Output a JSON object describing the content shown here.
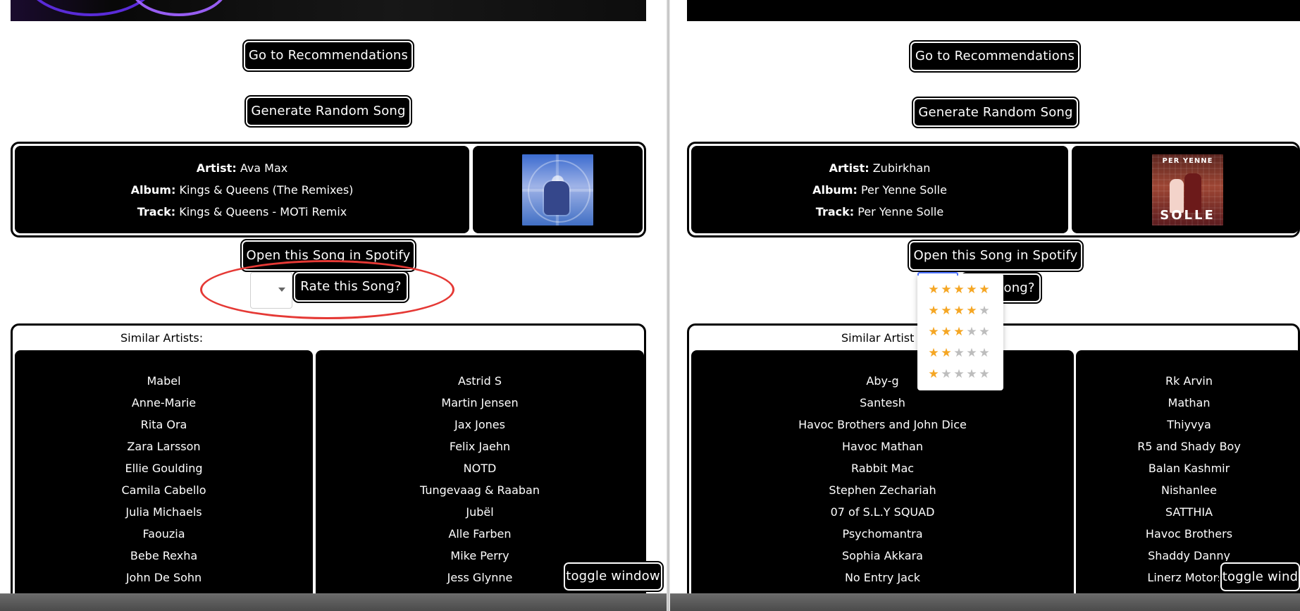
{
  "left_panel": {
    "buttons": {
      "recommendations": "Go to Recommendations",
      "random_song": "Generate Random Song",
      "open_spotify": "Open this Song in Spotify",
      "rate_song": "Rate this Song?",
      "toggle_window": "toggle window"
    },
    "song": {
      "artist_label": "Artist:",
      "artist": "Ava Max",
      "album_label": "Album:",
      "album": "Kings & Queens (The Remixes)",
      "track_label": "Track:",
      "track": "Kings & Queens - MOTi Remix"
    },
    "similar": {
      "title": "Similar Artists:",
      "column_a": [
        "Mabel",
        "Anne-Marie",
        "Rita Ora",
        "Zara Larsson",
        "Ellie Goulding",
        "Camila Cabello",
        "Julia Michaels",
        "Faouzia",
        "Bebe Rexha",
        "John De Sohn"
      ],
      "column_b": [
        "Astrid S",
        "Martin Jensen",
        "Jax Jones",
        "Felix Jaehn",
        "NOTD",
        "Tungevaag & Raaban",
        "Jubël",
        "Alle Farben",
        "Mike Perry",
        "Jess Glynne"
      ]
    },
    "annotation_color": "#e53935"
  },
  "right_panel": {
    "buttons": {
      "recommendations": "Go to Recommendations",
      "random_song": "Generate Random Song",
      "open_spotify": "Open this Song in Spotify",
      "rate_song_visible": "this Song?",
      "toggle_window_visible": "toggle wind"
    },
    "song": {
      "artist_label": "Artist:",
      "artist": "Zubirkhan",
      "album_label": "Album:",
      "album": "Per Yenne Solle",
      "track_label": "Track:",
      "track": "Per Yenne Solle",
      "cover_top_text": "PER YENNE",
      "cover_bottom_text": "SOLLE"
    },
    "similar": {
      "title_visible": "Similar Artist",
      "column_a_first_visible": "Aby-g",
      "column_a": [
        "Santesh",
        "Havoc Brothers and John Dice",
        "Havoc Mathan",
        "Rabbit Mac",
        "Stephen Zechariah",
        "07 of S.L.Y SQUAD",
        "Psychomantra",
        "Sophia Akkara",
        "No Entry Jack"
      ],
      "column_b": [
        "Rk Arvin",
        "Mathan",
        "Thiyvya",
        "R5 and Shady Boy",
        "Balan Kashmir",
        "Nishanlee",
        "SATTHIA",
        "Havoc Brothers",
        "Shaddy Danny",
        "Linerz Motorsp"
      ]
    },
    "rating_options": [
      {
        "value": 5,
        "label": "5 stars"
      },
      {
        "value": 4,
        "label": "4 stars"
      },
      {
        "value": 3,
        "label": "3 stars"
      },
      {
        "value": 2,
        "label": "2 stars"
      },
      {
        "value": 1,
        "label": "1 star"
      }
    ],
    "star_colors": {
      "filled": "#f5a623",
      "empty": "#bdbdbd"
    }
  }
}
